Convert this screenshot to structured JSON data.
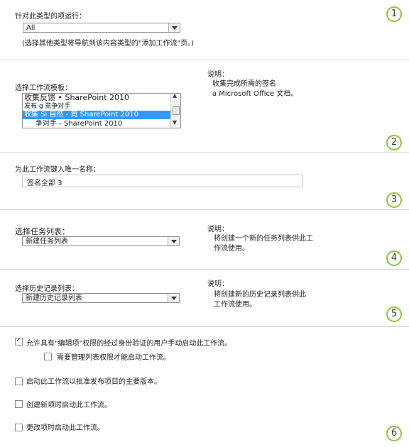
{
  "section1": {
    "label": "针对此类型的项运行：",
    "select_value": "All",
    "note": "(选择其他类型将导航到该内容类型的\"添加工作流\"页。)",
    "number": "1"
  },
  "section2": {
    "label": "选择工作流模板：",
    "options": [
      "收集反馈 • SharePoint 2010",
      "发布        g 竞争对手",
      "收集              Si 自然 - 竟    SharePoint 2010",
      "争对手 - SharePoint 2010"
    ],
    "desc_title": "说明：",
    "desc_line1": "收集完成所需的签名",
    "desc_line2": "a  Microsoft Office 文档。",
    "number": "2"
  },
  "section3": {
    "label": "为此工作流键入唯一名称：",
    "input_value": "签名全部 3",
    "number": "3"
  },
  "section4": {
    "label": "选择任务列表：",
    "select_value": "新建任务列表",
    "desc_title": "说明：",
    "desc_line1": "将创建一个新的任务列表供此工",
    "desc_line2": "作流使用。",
    "number": "4"
  },
  "section5": {
    "label": "选择历史记录列表：",
    "select_value": "新建历史记录列表",
    "desc_title": "说明：",
    "desc_line1": "将创建新的历史记录列表供此",
    "desc_line2": "工作流使用。",
    "number": "5"
  },
  "section6": {
    "opt1": "允许具有\"编辑项\"权限的经过身份验证的用户手动启动此工作流。",
    "opt1_sub": "需要管理列表权限才能启动工作流。",
    "opt2": "启动此工作流以批准发布项目的主要版本。",
    "opt3": "创建新项时启动此工作流。",
    "opt4": "更改项时启动此工作流。",
    "number": "6"
  }
}
